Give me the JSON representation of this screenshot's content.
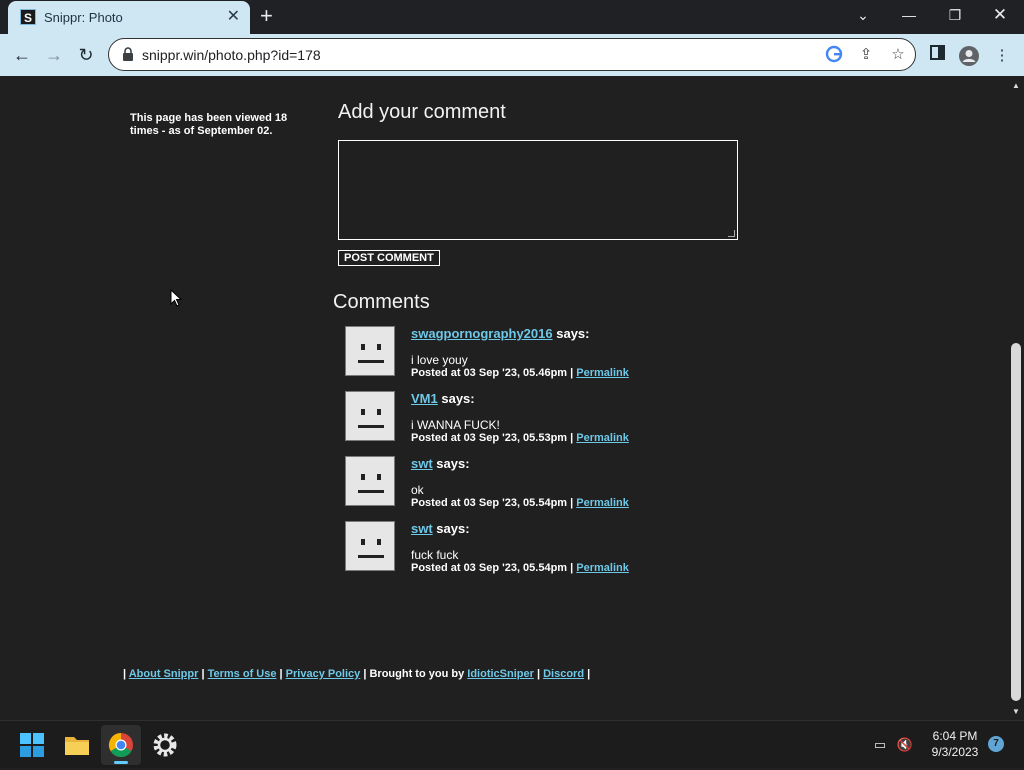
{
  "browser": {
    "tab_title": "Snippr: Photo",
    "tab_favicon_letter": "S",
    "url": "snippr.win/photo.php?id=178"
  },
  "sidebar": {
    "views_text": "This page has been viewed 18 times - as of September 02."
  },
  "comment_form": {
    "heading": "Add your comment",
    "textarea_value": "",
    "post_button": "POST COMMENT"
  },
  "comments_section": {
    "heading": "Comments",
    "items": [
      {
        "user": "swagpornography2016",
        "says": "says:",
        "text": "i love youy",
        "posted": "Posted at 03 Sep '23, 05.46pm |",
        "permalink": "Permalink"
      },
      {
        "user": "VM1",
        "says": "says:",
        "text": "i WANNA FUCK!",
        "posted": "Posted at 03 Sep '23, 05.53pm |",
        "permalink": "Permalink"
      },
      {
        "user": "swt",
        "says": "says:",
        "text": "ok",
        "posted": "Posted at 03 Sep '23, 05.54pm |",
        "permalink": "Permalink"
      },
      {
        "user": "swt",
        "says": "says:",
        "text": "fuck fuck",
        "posted": "Posted at 03 Sep '23, 05.54pm |",
        "permalink": "Permalink"
      }
    ]
  },
  "footer": {
    "sep": "|",
    "about": "About Snippr",
    "terms": "Terms of Use",
    "privacy": "Privacy Policy",
    "brought": "Brought to you by",
    "author": "IdioticSniper",
    "discord": "Discord"
  },
  "taskbar": {
    "time": "6:04 PM",
    "date": "9/3/2023",
    "notification_count": "7"
  },
  "colors": {
    "page_bg": "#202020",
    "link": "#6ec8e8",
    "tab_bg": "#cfe6f3"
  }
}
